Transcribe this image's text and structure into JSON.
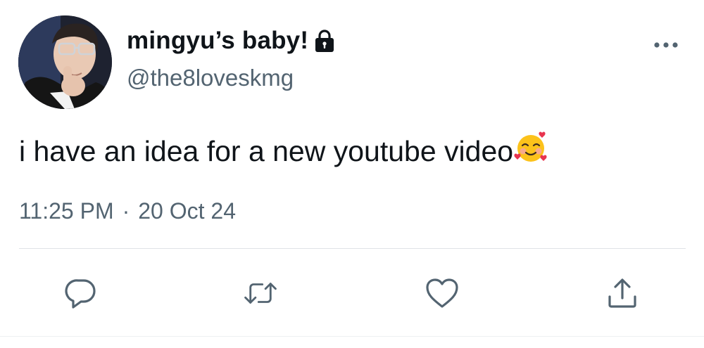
{
  "tweet": {
    "display_name": "mingyu’s baby!",
    "handle": "@the8loveskmg",
    "text": "i have an idea for a new youtube video",
    "emoji_icon": "smiling-face-with-hearts-icon",
    "time": "11:25 PM",
    "separator": "·",
    "date": "20 Oct 24",
    "protected_icon": "lock-icon",
    "more_icon": "more-horizontal-icon"
  },
  "actions": [
    {
      "name": "reply",
      "icon": "reply-icon"
    },
    {
      "name": "retweet",
      "icon": "retweet-icon"
    },
    {
      "name": "like",
      "icon": "heart-icon"
    },
    {
      "name": "share",
      "icon": "share-icon"
    }
  ],
  "colors": {
    "text_primary": "#0f1419",
    "text_secondary": "#536471",
    "icon": "#536471",
    "divider": "#dfe3e6",
    "background": "#ffffff"
  }
}
